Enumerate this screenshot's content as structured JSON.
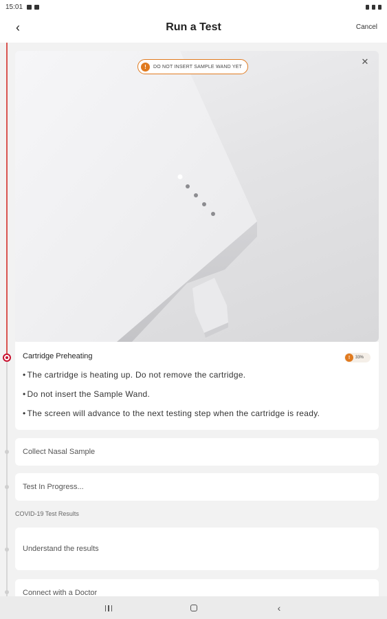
{
  "status_bar": {
    "time": "15:01"
  },
  "header": {
    "back_glyph": "‹",
    "title": "Run a Test",
    "cancel_label": "Cancel"
  },
  "image_card": {
    "warning_text": "DO NOT INSERT SAMPLE WAND YET",
    "warning_icon_glyph": "!",
    "close_glyph": "✕"
  },
  "current_step": {
    "title": "Cartridge Preheating",
    "progress_text": "33%",
    "progress_value": 33,
    "progress_icon_glyph": "!",
    "bullets": [
      "The cartridge is heating up. Do not remove the cartridge.",
      "Do not insert the Sample Wand.",
      "The screen will advance to the next testing step when the cartridge is ready."
    ]
  },
  "steps": [
    {
      "label": "Collect Nasal Sample"
    },
    {
      "label": "Test In Progress..."
    }
  ],
  "results_section": {
    "label": "COVID-19 Test Results",
    "steps": [
      {
        "label": "Understand the results"
      },
      {
        "label": "Connect with a Doctor"
      }
    ]
  },
  "nav_bar": {
    "back_glyph": "‹"
  },
  "colors": {
    "accent_red": "#c8102e",
    "warning_orange": "#e07a1f",
    "background": "#f2f2f2"
  },
  "icons": [
    "back-arrow-icon",
    "warning-icon",
    "close-icon",
    "recents-icon",
    "home-icon",
    "system-back-icon"
  ]
}
